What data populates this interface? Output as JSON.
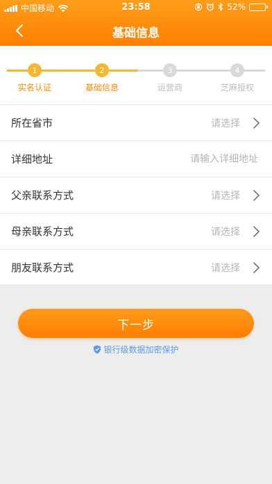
{
  "status_bar": {
    "carrier": "中国移动",
    "time": "23:58",
    "battery": "52%",
    "battery_level": 0.52,
    "icons": [
      "signal-icon",
      "wifi-icon",
      "lock-rotation-icon",
      "alarm-icon",
      "bluetooth-icon",
      "battery-icon"
    ]
  },
  "nav": {
    "title": "基础信息",
    "back_icon": "chevron-left-icon"
  },
  "colors": {
    "accent": "#ff8c00",
    "step_active": "#f5b630",
    "step_inactive": "#d9d9d9",
    "step_label_inactive": "#bbbbbb",
    "link_blue": "#5b9be6"
  },
  "steps": [
    {
      "num": "1",
      "label": "实名认证",
      "state": "done"
    },
    {
      "num": "2",
      "label": "基础信息",
      "state": "current"
    },
    {
      "num": "3",
      "label": "运营商",
      "state": "todo"
    },
    {
      "num": "4",
      "label": "芝麻授权",
      "state": "todo"
    }
  ],
  "form": {
    "rows": [
      {
        "label": "所在省市",
        "placeholder": "请选择",
        "type": "select"
      },
      {
        "label": "详细地址",
        "placeholder": "请输入详细地址",
        "type": "input"
      },
      {
        "label": "父亲联系方式",
        "placeholder": "请选择",
        "type": "select"
      },
      {
        "label": "母亲联系方式",
        "placeholder": "请选择",
        "type": "select"
      },
      {
        "label": "朋友联系方式",
        "placeholder": "请选择",
        "type": "select"
      }
    ]
  },
  "next_button": "下一步",
  "secure_note": "银行级数据加密保护"
}
